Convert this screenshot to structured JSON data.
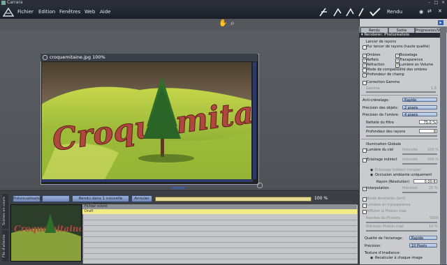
{
  "os": {
    "title": "Carrara"
  },
  "menu": [
    "Fichier",
    "Edition",
    "Fenêtres",
    "Web",
    "Aide"
  ],
  "header": {
    "rendu_label": "Rendu"
  },
  "render_window": {
    "title": "croquemitaine.jpg 100%",
    "scene_text": "Croquemitaine"
  },
  "bottom": {
    "tabs": [
      "Scènes en cours",
      "File d'attente"
    ],
    "buttons": [
      "Prévisualisation",
      "Rendu dans 1 nouvelle fenêtre",
      "Annuler"
    ],
    "progress": 1.0,
    "progress_label": "100 %",
    "queue_header": "Fichier scène",
    "queue_row": "Draft"
  },
  "right_panel": {
    "tabs": [
      "Rendu",
      "Sortie",
      "Progression/Stat"
    ],
    "section_title": "Renderer: Photoréaliste",
    "lancer": "Lancer de rayons",
    "pur_lancer": "Pur lancer de rayons (haute qualité)",
    "checks": {
      "ombres": "Ombres",
      "bosselage": "Bosselage",
      "reflets": "Reflets",
      "transparence": "Transparence",
      "refraction": "Réfraction",
      "lumiere_volume": "Lumière en Volume",
      "mode_compat": "Mode de compatibilité des ombres",
      "profondeur": "Profondeur de champ",
      "correction": "Correction Gamma"
    },
    "gamma_label": "Gamma",
    "gamma_value": "1.8",
    "anticrenelage_label": "Anti-crénelage:",
    "anticrenelage_value": "Rapide",
    "precision_objets_label": "Précision des objets:",
    "precision_objets_value": "2 pixels",
    "precision_ombre_label": "Précision de l'ombre:",
    "precision_ombre_value": "4 pixels",
    "nettete_label": "Netteté du filtre",
    "nettete_value": "75.0 %",
    "profondeur_rayons_label": "Profondeur des rayons",
    "profondeur_rayons_value": "8",
    "illum_globale": "Illumination Globale",
    "lumiere_ciel": "Lumière du ciel",
    "intensite": "Intensité",
    "intensite_value": "100 %",
    "eclairage_indirect": "Eclairage indirect",
    "eclairage_complet": "Eclairage indirect complet",
    "occlusion": "Occlusion ambiante uniquement",
    "rayon_label": "Rayon (Résolution)",
    "rayon_value": "0.00 ft",
    "interpolation": "Interpolation",
    "precision_label": "Précision",
    "precision_value": "25 %",
    "bords": "Bords Améliorés (lent)",
    "lumiere_transparence": "Lumière en transparence",
    "afficher_photon": "Afficher la Photon map",
    "nombre_photons": "Nombre de Photons",
    "nombre_photons_value": "5000",
    "precision_photon": "Précision Photon map",
    "precision_photon_value": "10 %",
    "qualite_eclairage_label": "Qualité de l'éclairage:",
    "qualite_eclairage_value": "Rapide",
    "precision2_label": "Précision:",
    "precision2_value": "10 Pixels",
    "texture_irradiance": "Texture d'irradiance:",
    "recalculer": "Recalculer à chaque image"
  },
  "colors": {
    "accent": "#6f86b8",
    "progress": "#dad08a",
    "queue_highlight": "#f2ec88"
  }
}
